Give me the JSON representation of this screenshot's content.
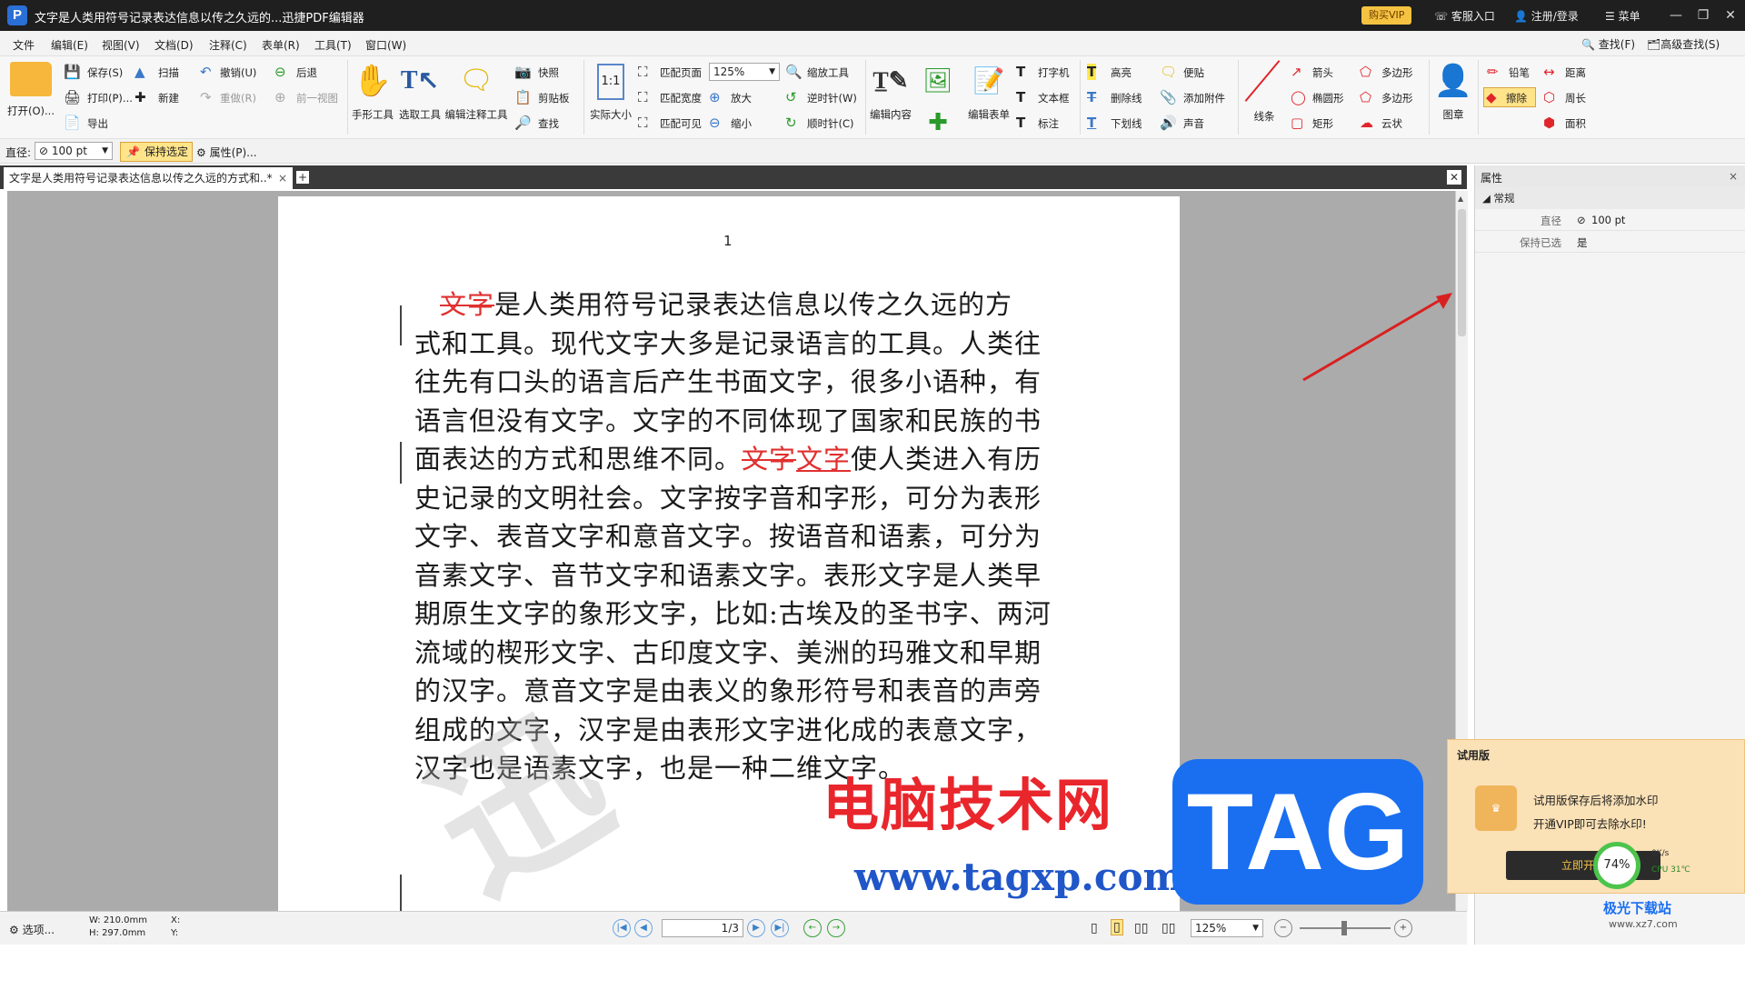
{
  "titlebar": {
    "title": "文字是人类用符号记录表达信息以传之久远的...迅捷PDF编辑器",
    "buy_vip": "购买VIP",
    "service": "客服入口",
    "login": "注册/登录",
    "menu": "菜单"
  },
  "menubar": {
    "items": [
      "文件",
      "编辑(E)",
      "视图(V)",
      "文档(D)",
      "注释(C)",
      "表单(R)",
      "工具(T)",
      "窗口(W)"
    ],
    "find": "查找(F)",
    "adv_find": "高级查找(S)"
  },
  "ribbon": {
    "open": "打开(O)...",
    "save": "保存(S)",
    "print": "打印(P)...",
    "export": "导出",
    "scan": "扫描",
    "new": "新建",
    "undo": "撤销(U)",
    "redo": "重做(R)",
    "back": "后退",
    "prev_view": "前一视图",
    "hand": "手形工具",
    "select": "选取工具",
    "edit_annot": "编辑注释工具",
    "snapshot": "快照",
    "clipboard": "剪贴板",
    "find": "查找",
    "actual": "实际大小",
    "fit_page": "匹配页面",
    "fit_width": "匹配宽度",
    "fit_visible": "匹配可见",
    "zoom": "125%",
    "zoom_in": "放大",
    "zoom_out": "缩小",
    "zoom_tool": "缩放工具",
    "ccw": "逆时针(W)",
    "cw": "顺时针(C)",
    "edit_content": "编辑内容",
    "add": "添加",
    "edit_form": "编辑表单",
    "typewriter": "打字机",
    "textbox": "文本框",
    "callout": "标注",
    "highlight": "高亮",
    "strike": "删除线",
    "underline": "下划线",
    "note": "便贴",
    "attach": "添加附件",
    "sound": "声音",
    "line": "线条",
    "arrow": "箭头",
    "ellipse": "椭圆形",
    "rect": "矩形",
    "polygon": "多边形",
    "polyline": "多边形",
    "cloud": "云状",
    "stamp": "图章",
    "pencil": "铅笔",
    "eraser": "擦除",
    "distance": "距离",
    "perimeter": "周长",
    "area": "面积"
  },
  "propbar": {
    "diameter_label": "直径:",
    "diameter_value": "100 pt",
    "keep_selected": "保持选定",
    "properties": "属性(P)..."
  },
  "tab": {
    "title": "文字是人类用符号记录表达信息以传之久远的方式和..*"
  },
  "document": {
    "page_number": "1",
    "lines": [
      {
        "pre": "",
        "red": "文字",
        "post": "是人类用符号记录表达信息以传之久远的方"
      },
      {
        "pre": "式和工具。现代文字大多是记录语言的工具。人类往"
      },
      {
        "pre": "往先有口头的语言后产生书面文字，很多小语种，有"
      },
      {
        "pre": "语言但没有文字。文字的不同体现了国家和民族的书"
      },
      {
        "pre": "面表达的方式和思维不同。",
        "red": "文字",
        "redu": "文字",
        "post": "使人类进入有历"
      },
      {
        "pre": "史记录的文明社会。文字按字音和字形，可分为表形"
      },
      {
        "pre": "文字、表音文字和意音文字。按语音和语素，可分为"
      },
      {
        "pre": "音素文字、音节文字和语素文字。表形文字是人类早"
      },
      {
        "pre": "期原生文字的象形文字，比如:古埃及的圣书字、两河"
      },
      {
        "pre": "流域的楔形文字、古印度文字、美洲的玛雅文和早期"
      },
      {
        "pre": "的汉字。意音文字是由表义的象形符号和表音的声旁"
      },
      {
        "pre": "组成的文字，汉字是由表形文字进化成的表意文字，"
      },
      {
        "pre": "汉字也是语素文字，也是一种二维文字。"
      }
    ]
  },
  "panel": {
    "title": "属性",
    "group": "常规",
    "rows": [
      {
        "k": "直径",
        "v": "100 pt"
      },
      {
        "k": "保持已选",
        "v": "是"
      }
    ]
  },
  "statusbar": {
    "select": "选项...",
    "w": "W: 210.0mm",
    "h": "H: 297.0mm",
    "x": "X:",
    "y": "Y:",
    "page": "1",
    "total": "/3",
    "zoom": "125%"
  },
  "trial": {
    "title": "试用版",
    "line1": "试用版保存后将添加水印",
    "line2": "开通VIP即可去除水印!",
    "btn": "立即开通",
    "pct": "74%",
    "net": "0K/s",
    "cpu": "CPU 31℃"
  },
  "watermark": {
    "brand": "电脑技术网",
    "url": "www.tagxp.com",
    "tag": "TAG",
    "corner": "极光下载站",
    "corner2": "www.xz7.com"
  }
}
